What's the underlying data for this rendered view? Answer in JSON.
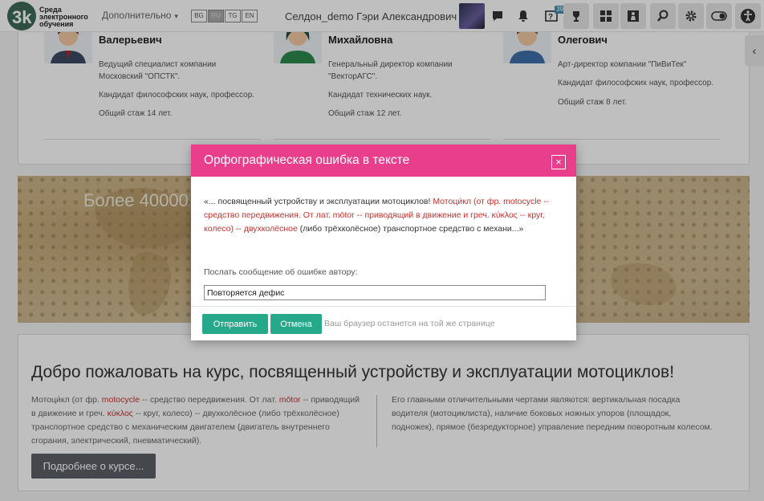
{
  "header": {
    "logo_lines": [
      "Среда",
      "электронного",
      "обучения"
    ],
    "logo_sub": "3.0%",
    "more_label": "Дополнительно",
    "languages": [
      {
        "code": "BG",
        "active": false
      },
      {
        "code": "RU",
        "active": true
      },
      {
        "code": "TG",
        "active": false
      },
      {
        "code": "EN",
        "active": false
      }
    ],
    "username": "Селдон_demo Гэри Александрович",
    "question_badge": "39",
    "icons": [
      "chat-icon",
      "bell-icon",
      "help-icon",
      "trophy-icon",
      "grid-icon",
      "chess-icon",
      "search-icon",
      "gear-icon",
      "toggle-icon",
      "accessibility-icon"
    ]
  },
  "teachers": [
    {
      "name": "Валерьевич",
      "lines": [
        "Ведущий специалист компании",
        "Московский \"ОПСТК\".",
        "Кандидат философских наук, профессор.",
        "Общий стаж 14 лет."
      ]
    },
    {
      "name": "Михайловна",
      "lines": [
        "Генеральный директор компании",
        "\"ВекторАГС\".",
        "Кандидат технических наук.",
        "Общий стаж 12 лет."
      ]
    },
    {
      "name": "Олегович",
      "lines": [
        "Арт-директор компании \"ПиВиТек\"",
        "Кандидат философских наук, профессор.",
        "Общий стаж 8 лет."
      ]
    }
  ],
  "banner": {
    "text": "Более 40000"
  },
  "course": {
    "title": "Добро пожаловать на курс, посвященный устройству и эксплуатации мотоциклов!",
    "left_parts": {
      "p1": "Мотоци́кл (от фр. ",
      "p2": "motocycle",
      "p3": " -- средство передвижения. От лат. ",
      "p4": "mōtor",
      "p5": " -- приводящий в движение и греч. ",
      "p6": "κύκλος",
      "p7": " -- круг, колесо) -- двухколёсное (либо трёхколёсное) транспортное средство с механическим двигателем (двигатель внутреннего сгорания, электрический, пневматический)."
    },
    "right_text": "Его главными отличительными чертами являются: вертикальная посадка водителя (мотоциклиста), наличие боковых ножных упоров (площадок, подножек), прямое (безредукторное) управление передним поворотным колесом.",
    "more_button": "Подробнее о курсе..."
  },
  "modal": {
    "title": "Орфографическая ошибка в тексте",
    "close": "×",
    "quote_plain_start": "«... посвященный устройству и эксплуатации мотоциклов! ",
    "quote_red": "Мотоци́кл (от фр. motocycle -- средство передвижения. От лат. mōtor -- приводящий в движение и греч. κύκλος -- круг, колесо) -- двухколёсное",
    "quote_plain_end": " (либо трёхколёсное) транспортное средство с механи...»",
    "label": "Послать сообщение об ошибке автору:",
    "input_value": "Повторяется дефис",
    "send_button": "Отправить",
    "cancel_button": "Отмена",
    "note": "Ваш браузер останется на той же странице"
  },
  "colors": {
    "accent_pink": "#e83e8c",
    "button_green": "#26a98b",
    "error_red": "#c9302c"
  }
}
